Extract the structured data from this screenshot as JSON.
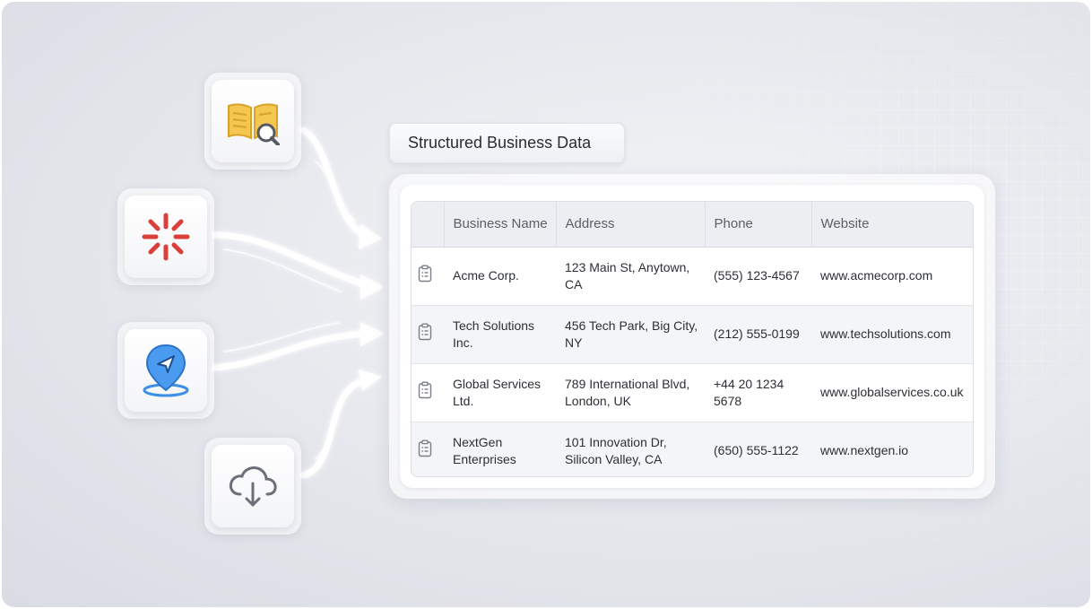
{
  "title": "Structured Business Data",
  "sources": [
    {
      "icon": "book-search-icon"
    },
    {
      "icon": "burst-icon"
    },
    {
      "icon": "location-pin-icon"
    },
    {
      "icon": "cloud-download-icon"
    }
  ],
  "colors": {
    "book": "#f2c14e",
    "burst": "#d9403a",
    "pin": "#3b8fe6",
    "cloud": "#6b7078",
    "accent_text": "#2a2d33"
  },
  "table": {
    "headers": [
      "Business Name",
      "Address",
      "Phone",
      "Website"
    ],
    "row_icon": "clipboard-list-icon",
    "rows": [
      {
        "name": "Acme Corp.",
        "address": "123 Main St, Anytown, CA",
        "phone": "(555) 123-4567",
        "website": "www.acmecorp.com"
      },
      {
        "name": "Tech Solutions Inc.",
        "address": "456 Tech Park, Big City, NY",
        "phone": "(212) 555-0199",
        "website": "www.techsolutions.com"
      },
      {
        "name": "Global Services Ltd.",
        "address": "789 International Blvd, London, UK",
        "phone": "+44 20 1234 5678",
        "website": "www.globalservices.co.uk"
      },
      {
        "name": "NextGen Enterprises",
        "address": "101 Innovation Dr, Silicon Valley, CA",
        "phone": "(650) 555-1122",
        "website": "www.nextgen.io"
      }
    ]
  }
}
